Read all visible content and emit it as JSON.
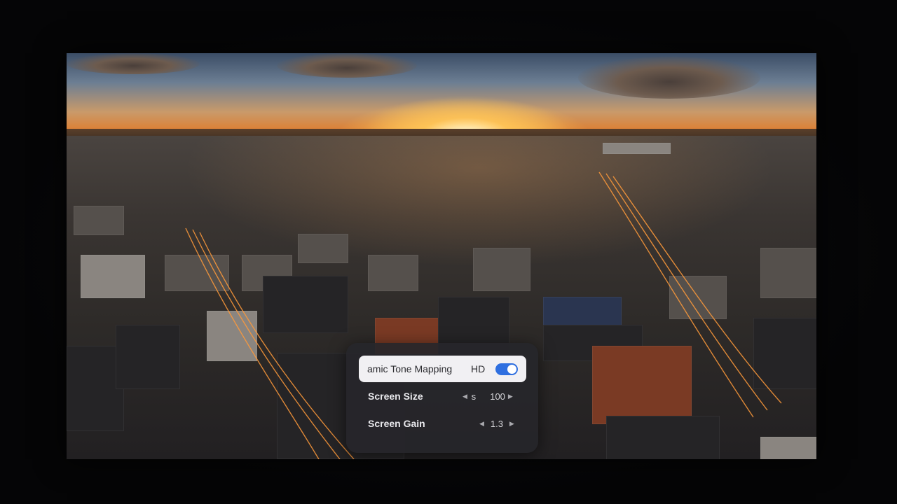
{
  "settings_menu": {
    "items": [
      {
        "label": "amic Tone Mapping",
        "badge": "HD",
        "toggle_on": true,
        "selected": true
      },
      {
        "label": "Screen Size",
        "value_partial": "s",
        "value": "100"
      },
      {
        "label": "Screen Gain",
        "value": "1.3"
      }
    ]
  },
  "icons": {
    "prev": "chevron-left-icon",
    "next": "chevron-right-icon"
  },
  "colors": {
    "toggle_accent": "#2f6fe0",
    "panel_background": "#26262a",
    "selected_row_background": "#f1f0f3"
  }
}
